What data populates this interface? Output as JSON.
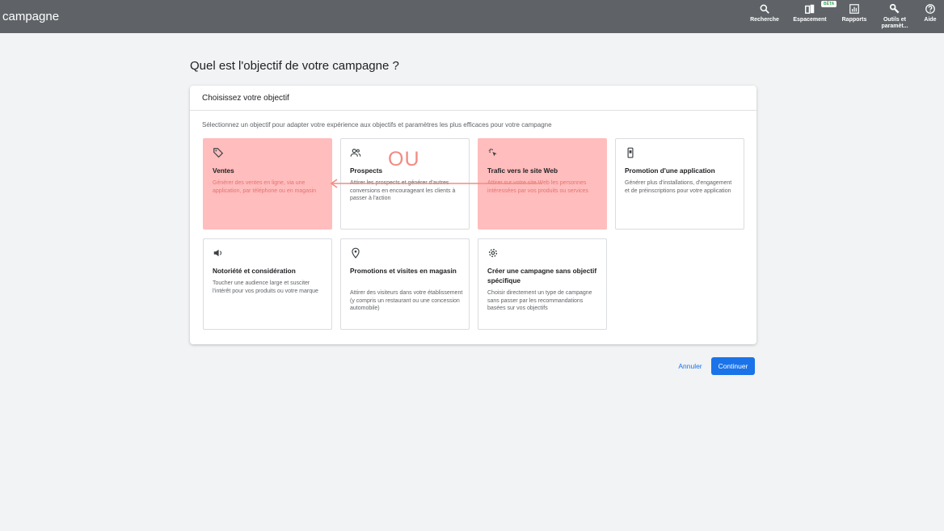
{
  "header": {
    "title": "campagne",
    "tools": {
      "search": "Recherche",
      "workspace": "Espacement",
      "workspace_badge": "BÊTA",
      "reports": "Rapports",
      "settings_line1": "Outils et",
      "settings_line2": "paramèt...",
      "help": "Aide"
    }
  },
  "page": {
    "heading": "Quel est l'objectif de votre campagne ?"
  },
  "card": {
    "header": "Choisissez votre objectif",
    "instruction": "Sélectionnez un objectif pour adapter votre expérience aux objectifs et paramètres les plus efficaces pour votre campagne",
    "objectives": [
      {
        "title": "Ventes",
        "description": "Générer des ventes en ligne, via une application, par téléphone ou en magasin",
        "icon": "tag-icon",
        "highlighted": true
      },
      {
        "title": "Prospects",
        "description": "Attirer les prospects et générer d'autres conversions en encourageant les clients à passer à l'action",
        "icon": "people-icon",
        "highlighted": false
      },
      {
        "title": "Trafic vers le site Web",
        "description": "Attirer sur votre site Web les personnes intéressées par vos produits ou services",
        "icon": "cursor-click-icon",
        "highlighted": true
      },
      {
        "title": "Promotion d'une application",
        "description": "Générer plus d'installations, d'engagement et de préinscriptions pour votre application",
        "icon": "phone-icon",
        "highlighted": false
      },
      {
        "title": "Notoriété et considération",
        "description": "Toucher une audience large et susciter l'intérêt pour vos produits ou votre marque",
        "icon": "speaker-icon",
        "highlighted": false
      },
      {
        "title": "Promotions et visites en magasin",
        "description": "Attirer des visiteurs dans votre établissement (y compris un restaurant ou une concession automobile)",
        "icon": "location-pin-icon",
        "highlighted": false
      },
      {
        "title": "Créer une campagne sans objectif spécifique",
        "description": "Choisir directement un type de campagne sans passer par les recommandations basées sur vos objectifs",
        "icon": "gear-icon",
        "highlighted": false
      }
    ]
  },
  "annotation": {
    "text": "OU",
    "color": "#f28b82"
  },
  "actions": {
    "cancel": "Annuler",
    "continue": "Continuer"
  },
  "colors": {
    "topbar": "#5f6368",
    "highlight": "#ffbdbd",
    "accent": "#1a73e8"
  }
}
